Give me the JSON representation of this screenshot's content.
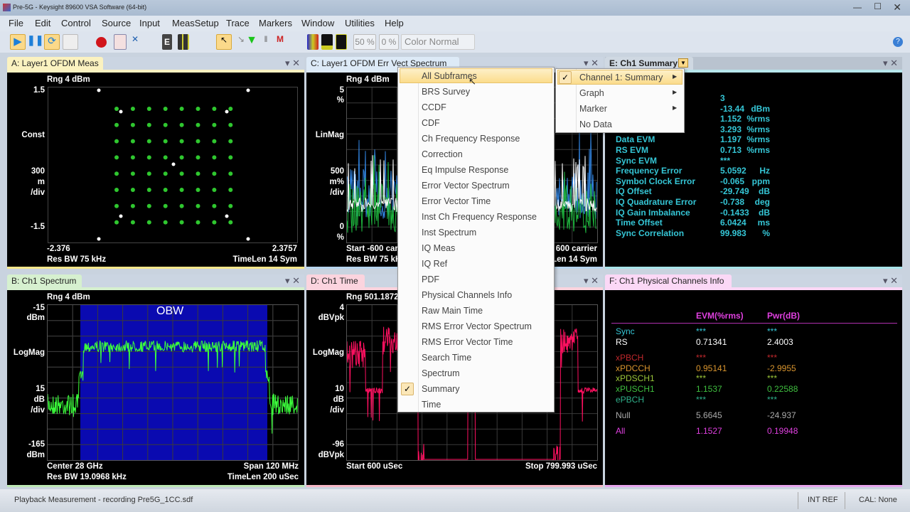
{
  "window": {
    "title": "Pre-5G - Keysight 89600 VSA Software (64-bit)"
  },
  "menubar": [
    "File",
    "Edit",
    "Control",
    "Source",
    "Input",
    "MeasSetup",
    "Trace",
    "Markers",
    "Window",
    "Utilities",
    "Help"
  ],
  "toolbar": {
    "zoom1": "50 %",
    "zoom2": "0 %",
    "color_mode": "Color Normal"
  },
  "panels": {
    "a": {
      "title": "A: Layer1 OFDM Meas",
      "rng": "Rng 4 dBm",
      "ytop": "1.5",
      "fmt": "Const",
      "scale1": "300",
      "scale2": "m",
      "scale3": "/div",
      "ybot": "-1.5",
      "xleft": "-2.376",
      "xright": "2.3757",
      "resbw": "Res BW 75 kHz",
      "timelen": "TimeLen 14  Sym"
    },
    "b": {
      "title": "B: Ch1 Spectrum",
      "rng": "Rng 4 dBm",
      "ytop1": "-15",
      "ytop2": "dBm",
      "fmt": "LogMag",
      "scale1": "15",
      "scale2": "dB",
      "scale3": "/div",
      "ybot1": "-165",
      "ybot2": "dBm",
      "obw": "OBW",
      "center": "Center 28 GHz",
      "span": "Span 120 MHz",
      "resbw": "Res BW 19.0968 kHz",
      "timelen": "TimeLen 200 uSec"
    },
    "c": {
      "title": "C: Layer1 OFDM Err Vect Spectrum",
      "rng": "Rng 4 dBm",
      "ytop1": "5",
      "ytop2": "%",
      "fmt": "LinMag",
      "scale1": "500",
      "scale2": "m%",
      "scale3": "/div",
      "ybot1": "0",
      "ybot2": "%",
      "start": "Start -600  carrier",
      "stop": "600  carrier",
      "resbw": "Res BW 75 kHz",
      "timelen": "TimeLen 14  Sym"
    },
    "d": {
      "title": "D: Ch1 Time",
      "rng": "Rng 501.1872",
      "ytop1": "4",
      "ytop2": "dBVpk",
      "fmt": "LogMag",
      "scale1": "10",
      "scale2": "dB",
      "scale3": "/div",
      "ybot1": "-96",
      "ybot2": "dBVpk",
      "start": "Start 600 uSec",
      "stop": "Stop 799.993 uSec"
    },
    "e": {
      "title": "E: Ch1 Summary",
      "rows": [
        {
          "label": "",
          "value": "3",
          "unit": ""
        },
        {
          "label": "",
          "value": "-13.44",
          "unit": "dBm"
        },
        {
          "label": "",
          "value": "1.152",
          "unit": "%rms"
        },
        {
          "label": "",
          "value": "3.293",
          "unit": "%rms"
        },
        {
          "label": "Data EVM",
          "value": "1.197",
          "unit": "%rms"
        },
        {
          "label": "RS EVM",
          "value": "0.713",
          "unit": "%rms"
        },
        {
          "label": "Sync EVM",
          "value": "***",
          "unit": ""
        },
        {
          "label": "Frequency Error",
          "value": "5.0592",
          "unit": "Hz"
        },
        {
          "label": "Symbol Clock Error",
          "value": "-0.065",
          "unit": "ppm"
        },
        {
          "label": "IQ Offset",
          "value": "-29.749",
          "unit": "dB"
        },
        {
          "label": "IQ Quadrature Error",
          "value": "-0.738",
          "unit": "deg"
        },
        {
          "label": "IQ Gain Imbalance",
          "value": "-0.1433",
          "unit": "dB"
        },
        {
          "label": "Time Offset",
          "value": "6.0424",
          "unit": "ms"
        },
        {
          "label": "Sync Correlation",
          "value": "99.983",
          "unit": "%"
        }
      ]
    },
    "f": {
      "title": "F: Ch1 Physical Channels Info",
      "col1": "EVM(%rms)",
      "col2": "Pwr(dB)",
      "rows": [
        {
          "name": "Sync",
          "evm": "***",
          "pwr": "***",
          "color": "#35c6d6"
        },
        {
          "name": "RS",
          "evm": "0.71341",
          "pwr": "2.4003",
          "color": "#ffffff"
        },
        {
          "name": "xPBCH",
          "evm": "***",
          "pwr": "***",
          "color": "#c0282c"
        },
        {
          "name": "xPDCCH",
          "evm": "0.95141",
          "pwr": "-2.9955",
          "color": "#d9952e"
        },
        {
          "name": "xPDSCH1",
          "evm": "***",
          "pwr": "***",
          "color": "#9cc63a"
        },
        {
          "name": "xPUSCH1",
          "evm": "1.1537",
          "pwr": "0.22588",
          "color": "#3fbf3f"
        },
        {
          "name": "ePBCH",
          "evm": "***",
          "pwr": "***",
          "color": "#2fb08a"
        },
        {
          "name": "Null",
          "evm": "5.6645",
          "pwr": "-24.937",
          "color": "#aaaaaa"
        },
        {
          "name": "All",
          "evm": "1.1527",
          "pwr": "0.19948",
          "color": "#e040e0"
        }
      ]
    }
  },
  "context_menu": {
    "items": [
      "All Subframes",
      "BRS Survey",
      "CCDF",
      "CDF",
      "Ch Frequency Response",
      "Correction",
      "Eq Impulse Response",
      "Error Vector Spectrum",
      "Error Vector Time",
      "Inst Ch Frequency Response",
      "Inst Spectrum",
      "IQ Meas",
      "IQ Ref",
      "PDF",
      "Physical Channels Info",
      "Raw Main Time",
      "RMS Error Vector Spectrum",
      "RMS Error Vector Time",
      "Search Time",
      "Spectrum",
      "Summary",
      "Time"
    ],
    "checked": "Summary",
    "hovered": "All Subframes"
  },
  "submenu": {
    "items": [
      "Channel 1: Summary",
      "Graph",
      "Marker",
      "No Data"
    ],
    "checked": "Channel 1: Summary"
  },
  "status": {
    "message": "Playback Measurement - recording Pre5G_1CC.sdf",
    "ref": "INT REF",
    "cal": "CAL: None"
  }
}
